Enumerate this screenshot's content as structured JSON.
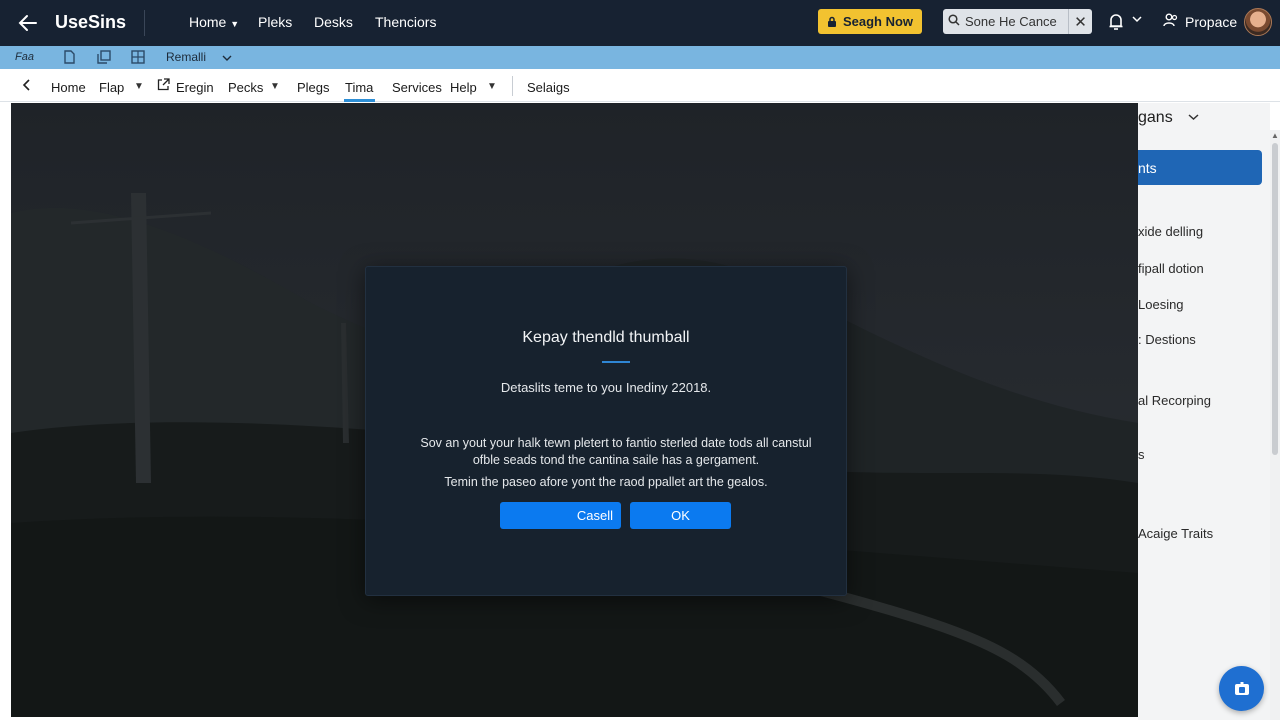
{
  "header": {
    "app_name": "UseSins",
    "nav": [
      {
        "label": "Home",
        "has_dropdown": true
      },
      {
        "label": "Pleks"
      },
      {
        "label": "Desks"
      },
      {
        "label": "Thenciors"
      }
    ],
    "cta_label": "Seagh Now",
    "search": {
      "value": "Sone He Cance"
    },
    "user_name": "Propace"
  },
  "bluebar": {
    "file_label": "Faa",
    "menu_label": "Remalli"
  },
  "menubar": {
    "items": [
      "Home",
      "Flap",
      "Eregin",
      "Pecks",
      "Plegs",
      "Tima",
      "Services",
      "Help",
      "Selaigs"
    ],
    "active": "Tima"
  },
  "right_panel": {
    "title": "gans",
    "primary_button": "nts",
    "items": [
      "xide delling",
      "fipall dotion",
      "Loesing",
      ": Destions",
      "al Recorping",
      "s",
      "Acaige Traits"
    ]
  },
  "modal": {
    "title": "Kepay thendld thumball",
    "subtitle": "Detaslits teme to you Inediny 22018.",
    "body": "Sov an yout your halk tewn pletert to fantio sterled date tods all canstul ofble seads tond the cantina saile has a gergament.",
    "note": "Temin the paseo afore yont the raod ppallet art the gealos.",
    "cancel_label": "Casell",
    "ok_label": "OK"
  },
  "colors": {
    "header_bg": "#172232",
    "cta_bg": "#f2c230",
    "bluebar_bg": "#79b5e0",
    "active_tab": "#2e8fd6",
    "modal_bg": "#17222e",
    "modal_button": "#0b7af0",
    "panel_button": "#1f66b5"
  }
}
